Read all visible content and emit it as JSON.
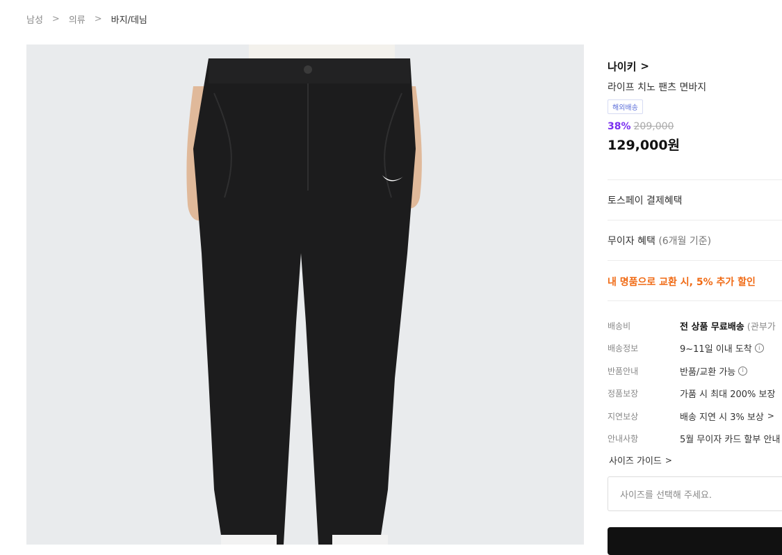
{
  "breadcrumb": {
    "items": [
      "남성",
      "의류",
      "바지/데님"
    ],
    "separator": ">"
  },
  "product": {
    "brand": "나이키",
    "brand_chevron": ">",
    "name": "라이프 치노 팬츠 면바지",
    "tag": "해외배송",
    "discount": "38%",
    "original_price": "209,000",
    "sale_price": "129,000원"
  },
  "benefits": {
    "toss": "토스페이 결제혜택",
    "installment_main": "무이자 혜택",
    "installment_note": "(6개월 기준)",
    "promo": "내 명품으로 교환 시, 5% 추가 할인"
  },
  "details": {
    "shipping_fee_label": "배송비",
    "shipping_fee_value": "전 상품 무료배송",
    "shipping_fee_note": "(관부가",
    "shipping_info_label": "배송정보",
    "shipping_info_value": "9~11일 이내 도착",
    "return_label": "반품안내",
    "return_value": "반품/교환 가능",
    "authentic_label": "정품보장",
    "authentic_value": "가품 시 최대 200% 보장",
    "delay_label": "지연보상",
    "delay_value": "배송 지연 시 3% 보상",
    "notice_label": "안내사항",
    "notice_value": "5월 무이자 카드 할부 안내"
  },
  "size": {
    "guide_label": "사이즈 가이드",
    "select_placeholder": "사이즈를 선택해 주세요."
  },
  "colors": {
    "discount": "#7a2ff0",
    "promo": "#f06a14",
    "tag": "#5a6dd8"
  }
}
